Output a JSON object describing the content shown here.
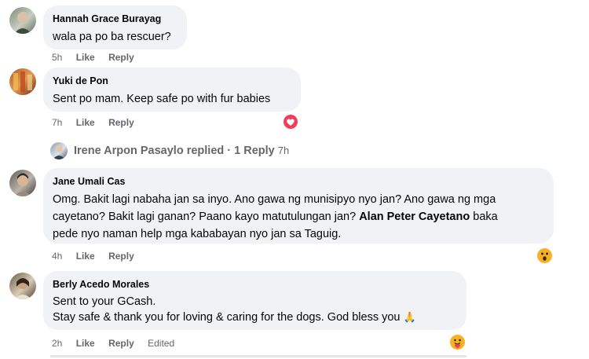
{
  "colors": {
    "bubble_bg": "#f0f2f5",
    "meta_gray": "#65676b",
    "love_reaction": "#f33e58",
    "wow_reaction": "#f7b125"
  },
  "comments": [
    {
      "author": "Hannah Grace Burayag",
      "lines": [
        "wala pa po ba rescuer?"
      ],
      "time": "5h",
      "like": "Like",
      "reply": "Reply"
    },
    {
      "author": "Yuki de Pon",
      "lines": [
        "Sent po mam. Keep safe po with fur babies"
      ],
      "time": "7h",
      "like": "Like",
      "reply": "Reply",
      "reaction": "love-reaction-icon"
    },
    {
      "author": "Jane Umali Cas",
      "lines": [
        "Omg. Bakit lagi nabaha jan sa inyo. Ano gawa ng munisipyo nyo jan? Ano gawa ng mga",
        "cayetano? Bakit lagi ganan? Paano kayo matutulungan jan?",
        "Alan Peter Cayetano",
        "baka",
        "pede nyo naman help mga kababayan nyo jan sa Taguig."
      ],
      "time": "4h",
      "like": "Like",
      "reply": "Reply",
      "reaction": "wow-reaction-icon"
    },
    {
      "author": "Berly Acedo Morales",
      "lines": [
        "Sent to your GCash.",
        "Stay safe & thank you for loving & caring for the dogs. God bless you",
        "🙏"
      ],
      "time": "2h",
      "like": "Like",
      "reply": "Reply",
      "edited": "Edited",
      "reaction": "care-reaction-icon"
    }
  ],
  "replies": {
    "name": "Irene Arpon Pasaylo replied",
    "sep": "·",
    "count": "1 Reply",
    "time": "7h"
  }
}
